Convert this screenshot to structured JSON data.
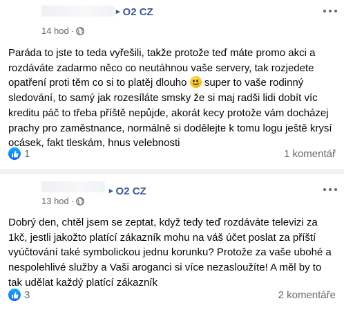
{
  "posts": [
    {
      "author": "O2 CZ",
      "time": "14 hod",
      "separator": "·",
      "text_before_emoji": "Paráda to jste to teda vyřešili, takže protože teď máte promo akci a rozdáváte zadarmo něco co neutáhnou vaše servery, tak rozjedete opatření proti těm co si to platěj dlouho",
      "emoji": "laughing-face-emoji",
      "text_after_emoji": " super to vaše rodinný sledování, to samý jak rozesíláte smsky že si maj radši lidi dobít víc kreditu páč to třeba příště nepůjde, akorát kecy protože vám docházej prachy pro zaměstnance, normálně si dodělejte k tomu logu ještě krysí ocásek, fakt tleskám, hnus velebnosti",
      "reaction_count": "1",
      "comments": "1 komentář"
    },
    {
      "author": "O2 CZ",
      "time": "13 hod",
      "separator": "·",
      "text": "Dobrý den, chtěl jsem se zeptat, když tedy teď rozdáváte televizi za 1kč, jestli jakožto platící zákazník mohu na váš účet poslat za příští vyúčtování také symbolickou jednu korunku? Protože za vaše ubohé a nespolehlivé služby a Vaši aroganci si více nezasloužíte! A měl by to tak udělat každý platící zákazník",
      "reaction_count": "3",
      "comments": "2 komentáře"
    }
  ],
  "colors": {
    "author_link": "#385898",
    "meta_text": "#65676b",
    "like_blue": "#0866ff",
    "background": "#f0f2f5"
  },
  "icons": [
    "globe-icon",
    "more-options-icon",
    "like-reaction-icon",
    "laughing-face-emoji"
  ]
}
